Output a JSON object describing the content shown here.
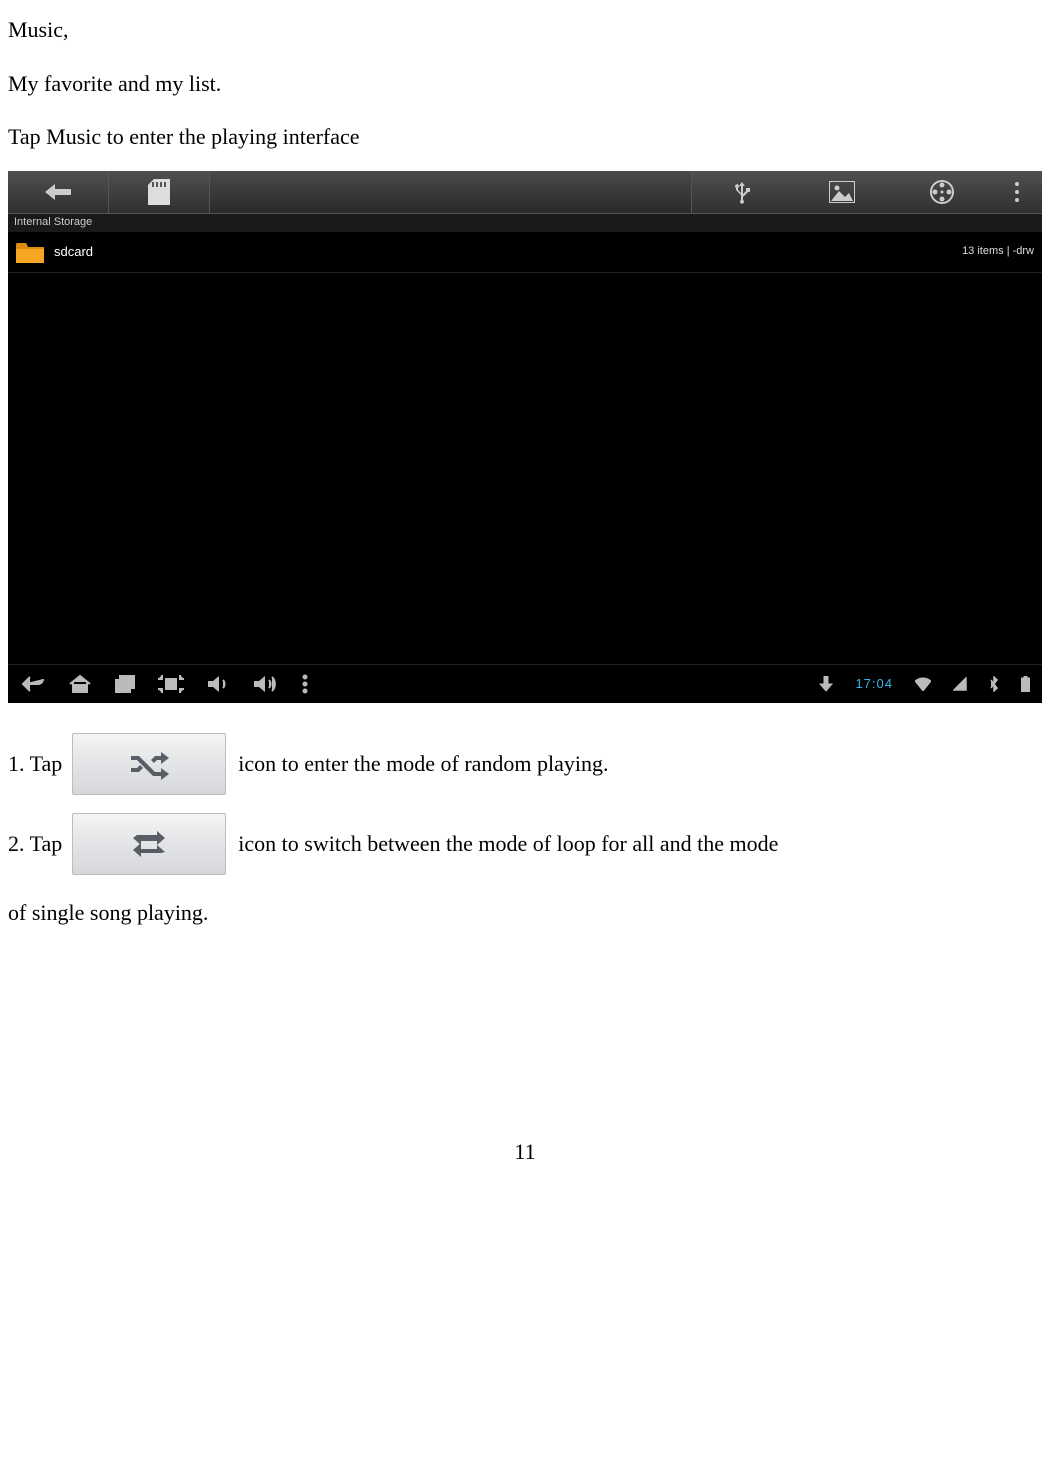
{
  "text": {
    "line1": "Music,",
    "line2": "My favorite and my list.",
    "line3": "Tap Music to enter the playing interface"
  },
  "screenshot": {
    "location": "Internal Storage",
    "folder_name": "sdcard",
    "meta": "13 items | -drw",
    "clock": "17:04"
  },
  "instructions": {
    "i1_pre": "1. Tap",
    "i1_post": "icon to enter the mode of random playing.",
    "i2_pre": "2. Tap",
    "i2_post": "icon to switch between the mode of loop for all and the mode",
    "i2_line2": "of single song playing."
  },
  "page_number": "11"
}
